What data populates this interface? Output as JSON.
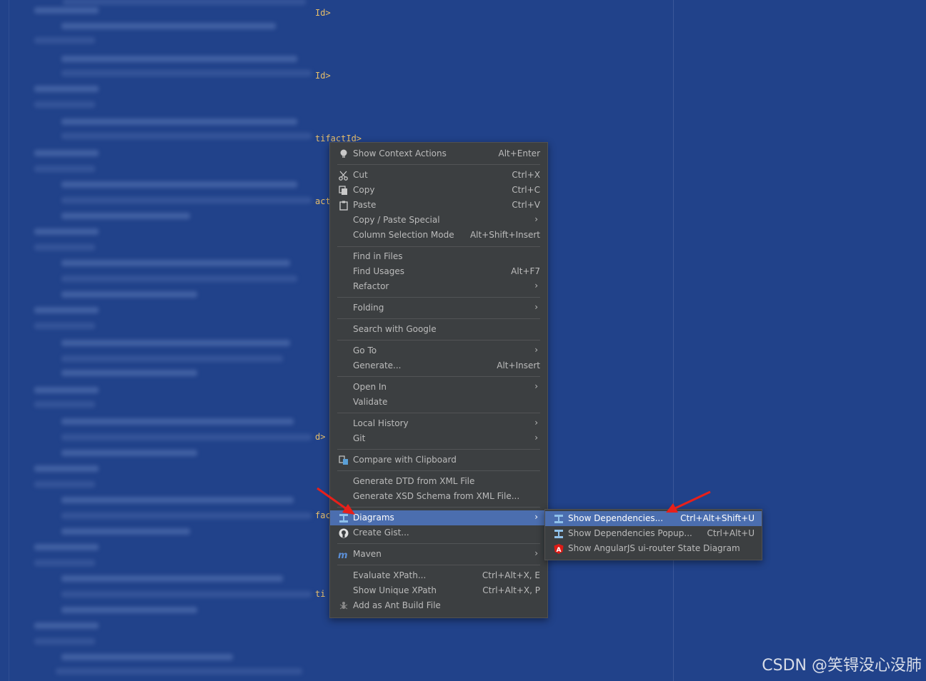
{
  "editor": {
    "code_fragments": [
      "Id>",
      "Id>",
      "tifactId>",
      "act",
      "d>",
      "fac",
      "ti"
    ]
  },
  "context_menu": {
    "items": [
      {
        "label": "Show Context Actions",
        "shortcut": "Alt+Enter",
        "icon": "lightbulb-icon"
      },
      {
        "label": "Cut",
        "shortcut": "Ctrl+X",
        "icon": "scissors-icon"
      },
      {
        "label": "Copy",
        "shortcut": "Ctrl+C",
        "icon": "copy-icon"
      },
      {
        "label": "Paste",
        "shortcut": "Ctrl+V",
        "icon": "paste-icon"
      },
      {
        "label": "Copy / Paste Special",
        "submenu": true
      },
      {
        "label": "Column Selection Mode",
        "shortcut": "Alt+Shift+Insert"
      },
      {
        "label": "Find in Files"
      },
      {
        "label": "Find Usages",
        "shortcut": "Alt+F7"
      },
      {
        "label": "Refactor",
        "submenu": true
      },
      {
        "label": "Folding",
        "submenu": true
      },
      {
        "label": "Search with Google"
      },
      {
        "label": "Go To",
        "submenu": true
      },
      {
        "label": "Generate...",
        "shortcut": "Alt+Insert"
      },
      {
        "label": "Open In",
        "submenu": true
      },
      {
        "label": "Validate"
      },
      {
        "label": "Local History",
        "submenu": true
      },
      {
        "label": "Git",
        "submenu": true
      },
      {
        "label": "Compare with Clipboard",
        "icon": "compare-icon"
      },
      {
        "label": "Generate DTD from XML File"
      },
      {
        "label": "Generate XSD Schema from XML File..."
      },
      {
        "label": "Diagrams",
        "submenu": true,
        "selected": true,
        "icon": "diagram-icon"
      },
      {
        "label": "Create Gist...",
        "icon": "github-icon"
      },
      {
        "label": "Maven",
        "submenu": true,
        "icon": "maven-icon"
      },
      {
        "label": "Evaluate XPath...",
        "shortcut": "Ctrl+Alt+X, E"
      },
      {
        "label": "Show Unique XPath",
        "shortcut": "Ctrl+Alt+X, P"
      },
      {
        "label": "Add as Ant Build File",
        "icon": "ant-icon"
      }
    ]
  },
  "diagrams_submenu": {
    "items": [
      {
        "label": "Show Dependencies...",
        "shortcut": "Ctrl+Alt+Shift+U",
        "selected": true,
        "icon": "diagram-icon"
      },
      {
        "label": "Show Dependencies Popup...",
        "shortcut": "Ctrl+Alt+U",
        "icon": "diagram-icon"
      },
      {
        "label": "Show AngularJS ui-router State Diagram",
        "icon": "angular-icon"
      }
    ]
  },
  "watermark": "CSDN @笑锝没心没肺",
  "colors": {
    "editor_bg": "#21428a",
    "menu_bg": "#3c3f41",
    "selection": "#4b6eaf",
    "xml_tag": "#e8bf6a",
    "annotation_arrow": "#e8201a"
  }
}
